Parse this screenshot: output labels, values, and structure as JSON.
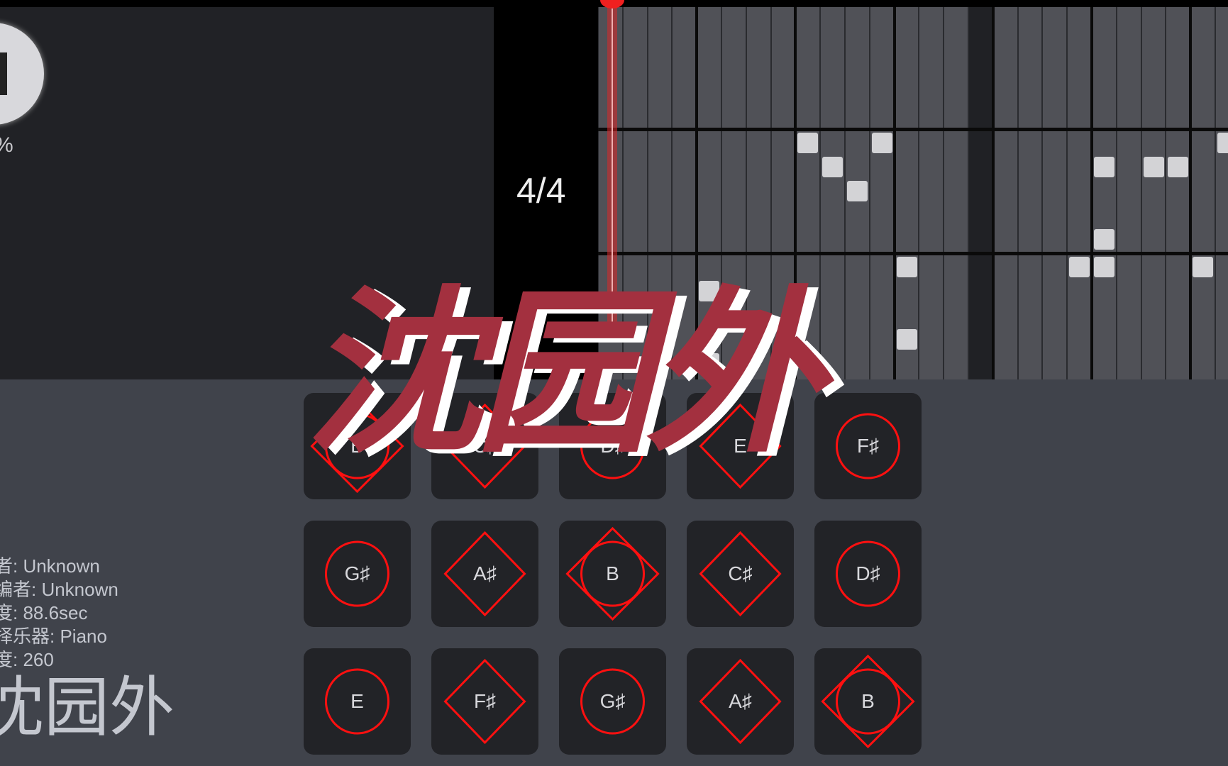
{
  "player": {
    "stop_icon": "stop-icon",
    "progress_text": "%",
    "time_signature": "4/4"
  },
  "piano_roll": {
    "columns": 26,
    "dark_columns": [
      15
    ],
    "beat_every": 4,
    "rows": 3,
    "slots_per_row": 5,
    "notes": [
      {
        "row": 1,
        "col": 8,
        "slot": 0
      },
      {
        "row": 1,
        "col": 9,
        "slot": 1
      },
      {
        "row": 1,
        "col": 10,
        "slot": 2
      },
      {
        "row": 1,
        "col": 11,
        "slot": 0
      },
      {
        "row": 1,
        "col": 20,
        "slot": 1
      },
      {
        "row": 1,
        "col": 22,
        "slot": 1
      },
      {
        "row": 1,
        "col": 23,
        "slot": 1
      },
      {
        "row": 1,
        "col": 25,
        "slot": 0
      },
      {
        "row": 1,
        "col": 20,
        "slot": 4
      },
      {
        "row": 2,
        "col": 4,
        "slot": 1
      },
      {
        "row": 2,
        "col": 4,
        "slot": 4
      },
      {
        "row": 2,
        "col": 12,
        "slot": 0
      },
      {
        "row": 2,
        "col": 12,
        "slot": 3
      },
      {
        "row": 2,
        "col": 19,
        "slot": 0
      },
      {
        "row": 2,
        "col": 20,
        "slot": 0
      },
      {
        "row": 2,
        "col": 24,
        "slot": 0
      }
    ],
    "playhead_color": "#f02020"
  },
  "pads": [
    [
      {
        "label": "B",
        "shape": "both"
      },
      {
        "label": "C♯",
        "shape": "diamond"
      },
      {
        "label": "D♯",
        "shape": "circle"
      },
      {
        "label": "E",
        "shape": "diamond"
      },
      {
        "label": "F♯",
        "shape": "circle"
      }
    ],
    [
      {
        "label": "G♯",
        "shape": "circle"
      },
      {
        "label": "A♯",
        "shape": "diamond"
      },
      {
        "label": "B",
        "shape": "both"
      },
      {
        "label": "C♯",
        "shape": "diamond"
      },
      {
        "label": "D♯",
        "shape": "circle"
      }
    ],
    [
      {
        "label": "E",
        "shape": "circle"
      },
      {
        "label": "F♯",
        "shape": "diamond"
      },
      {
        "label": "G♯",
        "shape": "circle"
      },
      {
        "label": "A♯",
        "shape": "diamond"
      },
      {
        "label": "B",
        "shape": "both"
      }
    ]
  ],
  "info": {
    "lines": [
      "者: Unknown",
      "编者: Unknown",
      "度: 88.6sec",
      "择乐器: Piano",
      "度: 260"
    ],
    "title": "沈园外"
  },
  "overlay": {
    "title": "沈园外",
    "color": "#a3303f"
  },
  "colors": {
    "pad_shape": "#ff1010",
    "bottom_bg": "#40434b",
    "pad_bg": "#222327"
  }
}
